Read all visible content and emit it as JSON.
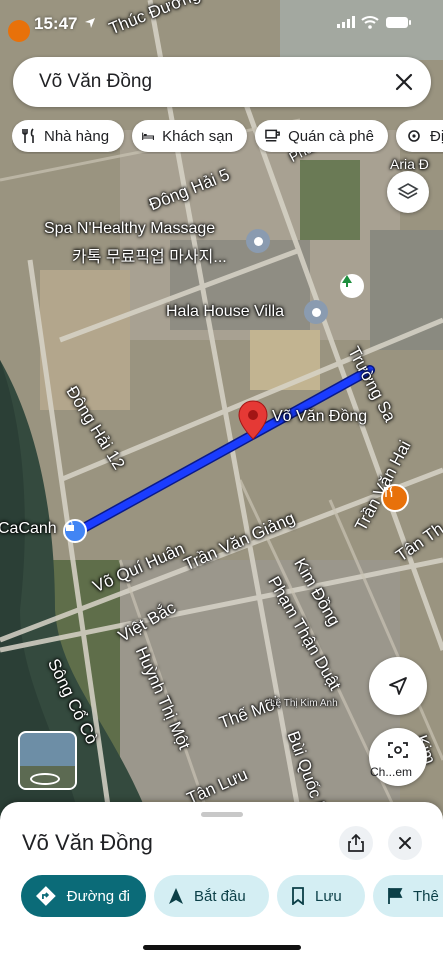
{
  "status_bar": {
    "time": "15:47"
  },
  "search": {
    "query": "Võ Văn Đồng"
  },
  "chips": [
    {
      "label": "Nhà hàng",
      "icon": "fork-knife-icon"
    },
    {
      "label": "Khách sạn",
      "icon": "bed-icon"
    },
    {
      "label": "Quán cà phê",
      "icon": "coffee-icon"
    },
    {
      "label": "Đị",
      "icon": "attraction-icon"
    }
  ],
  "map": {
    "route_color": "#1a3cff",
    "streets": [
      "Thúc Đường",
      "Trường Sa",
      "Đông Hải 5",
      "Đông Hải 12",
      "Trường Sa",
      "Trần Văn Giảng",
      "Võ Quí Huân",
      "Việt Bắc",
      "Huỳnh Thị Một",
      "Phạm Thận Duật",
      "Kim Đồng",
      "Trần Văn Hai",
      "Tân Th",
      "Bùi Quốc Kh",
      "Thế Mỡi",
      "Tân Lưu",
      "Sông Cổ Cò",
      "Phan Tứ",
      "Kim"
    ],
    "pois": {
      "spa": "Spa N'Healthy Massage",
      "spa_sub": "카톡 무료픽업 마사지...",
      "villa": "Hala House Villa",
      "selected": "Võ Văn Đồng",
      "left_edge": "CaCanh",
      "aria": "Aria Đ",
      "aria2": "H & ",
      "small_label": "Lê Thị Kim Anh"
    },
    "lens_label": "Ch...em"
  },
  "sheet": {
    "title": "Võ Văn Đồng",
    "actions": [
      {
        "label": "Đường đi",
        "icon": "directions-icon"
      },
      {
        "label": "Bắt đầu",
        "icon": "navigation-arrow-icon"
      },
      {
        "label": "Lưu",
        "icon": "bookmark-icon"
      },
      {
        "label": "Thê",
        "icon": "flag-icon"
      }
    ]
  }
}
